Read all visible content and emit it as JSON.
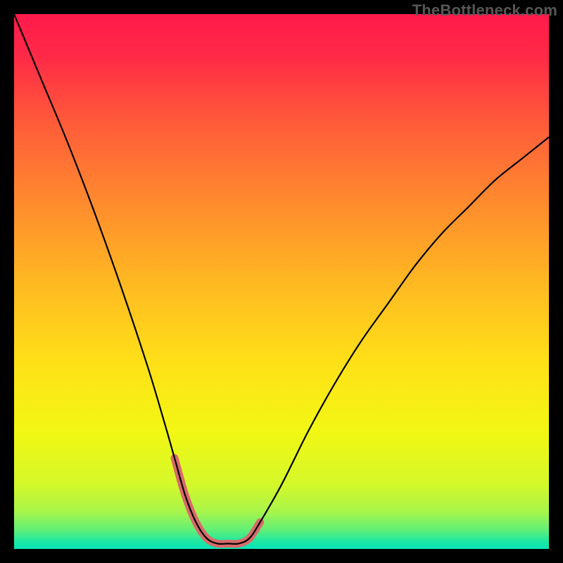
{
  "watermark": "TheBottleneck.com",
  "chart_data": {
    "type": "line",
    "title": "",
    "xlabel": "",
    "ylabel": "",
    "xlim": [
      0,
      100
    ],
    "ylim": [
      0,
      100
    ],
    "grid": false,
    "legend": false,
    "series": [
      {
        "name": "bottleneck-curve",
        "x": [
          0,
          5,
          10,
          15,
          20,
          25,
          28,
          30,
          32,
          34,
          36,
          38,
          40,
          42,
          44,
          46,
          50,
          55,
          60,
          65,
          70,
          75,
          80,
          85,
          90,
          95,
          100
        ],
        "y": [
          100,
          88,
          76,
          63,
          49,
          34,
          24,
          17,
          10,
          5,
          2,
          1,
          1,
          1,
          2,
          5,
          12,
          22,
          31,
          39,
          46,
          53,
          59,
          64,
          69,
          73,
          77
        ]
      },
      {
        "name": "highlight-band",
        "x": [
          30,
          32,
          34,
          36,
          38,
          40,
          42,
          44,
          46
        ],
        "y": [
          17,
          10,
          5,
          2,
          1,
          1,
          1,
          2,
          5
        ]
      }
    ],
    "annotations": []
  },
  "gradient": {
    "stops": [
      {
        "offset": 0.0,
        "color": "#ff1a4b"
      },
      {
        "offset": 0.08,
        "color": "#ff2a47"
      },
      {
        "offset": 0.2,
        "color": "#ff5a3a"
      },
      {
        "offset": 0.35,
        "color": "#ff8a2e"
      },
      {
        "offset": 0.5,
        "color": "#ffb822"
      },
      {
        "offset": 0.65,
        "color": "#ffe018"
      },
      {
        "offset": 0.78,
        "color": "#f2f713"
      },
      {
        "offset": 0.88,
        "color": "#d4f82a"
      },
      {
        "offset": 0.93,
        "color": "#a8f54a"
      },
      {
        "offset": 0.965,
        "color": "#60ef78"
      },
      {
        "offset": 0.985,
        "color": "#20e8a0"
      },
      {
        "offset": 1.0,
        "color": "#06e3b8"
      }
    ]
  },
  "curve_style": {
    "stroke": "#000000",
    "stroke_width": 2.2
  },
  "highlight_style": {
    "stroke": "#d96a6a",
    "stroke_width": 11,
    "linecap": "round",
    "linejoin": "round"
  }
}
